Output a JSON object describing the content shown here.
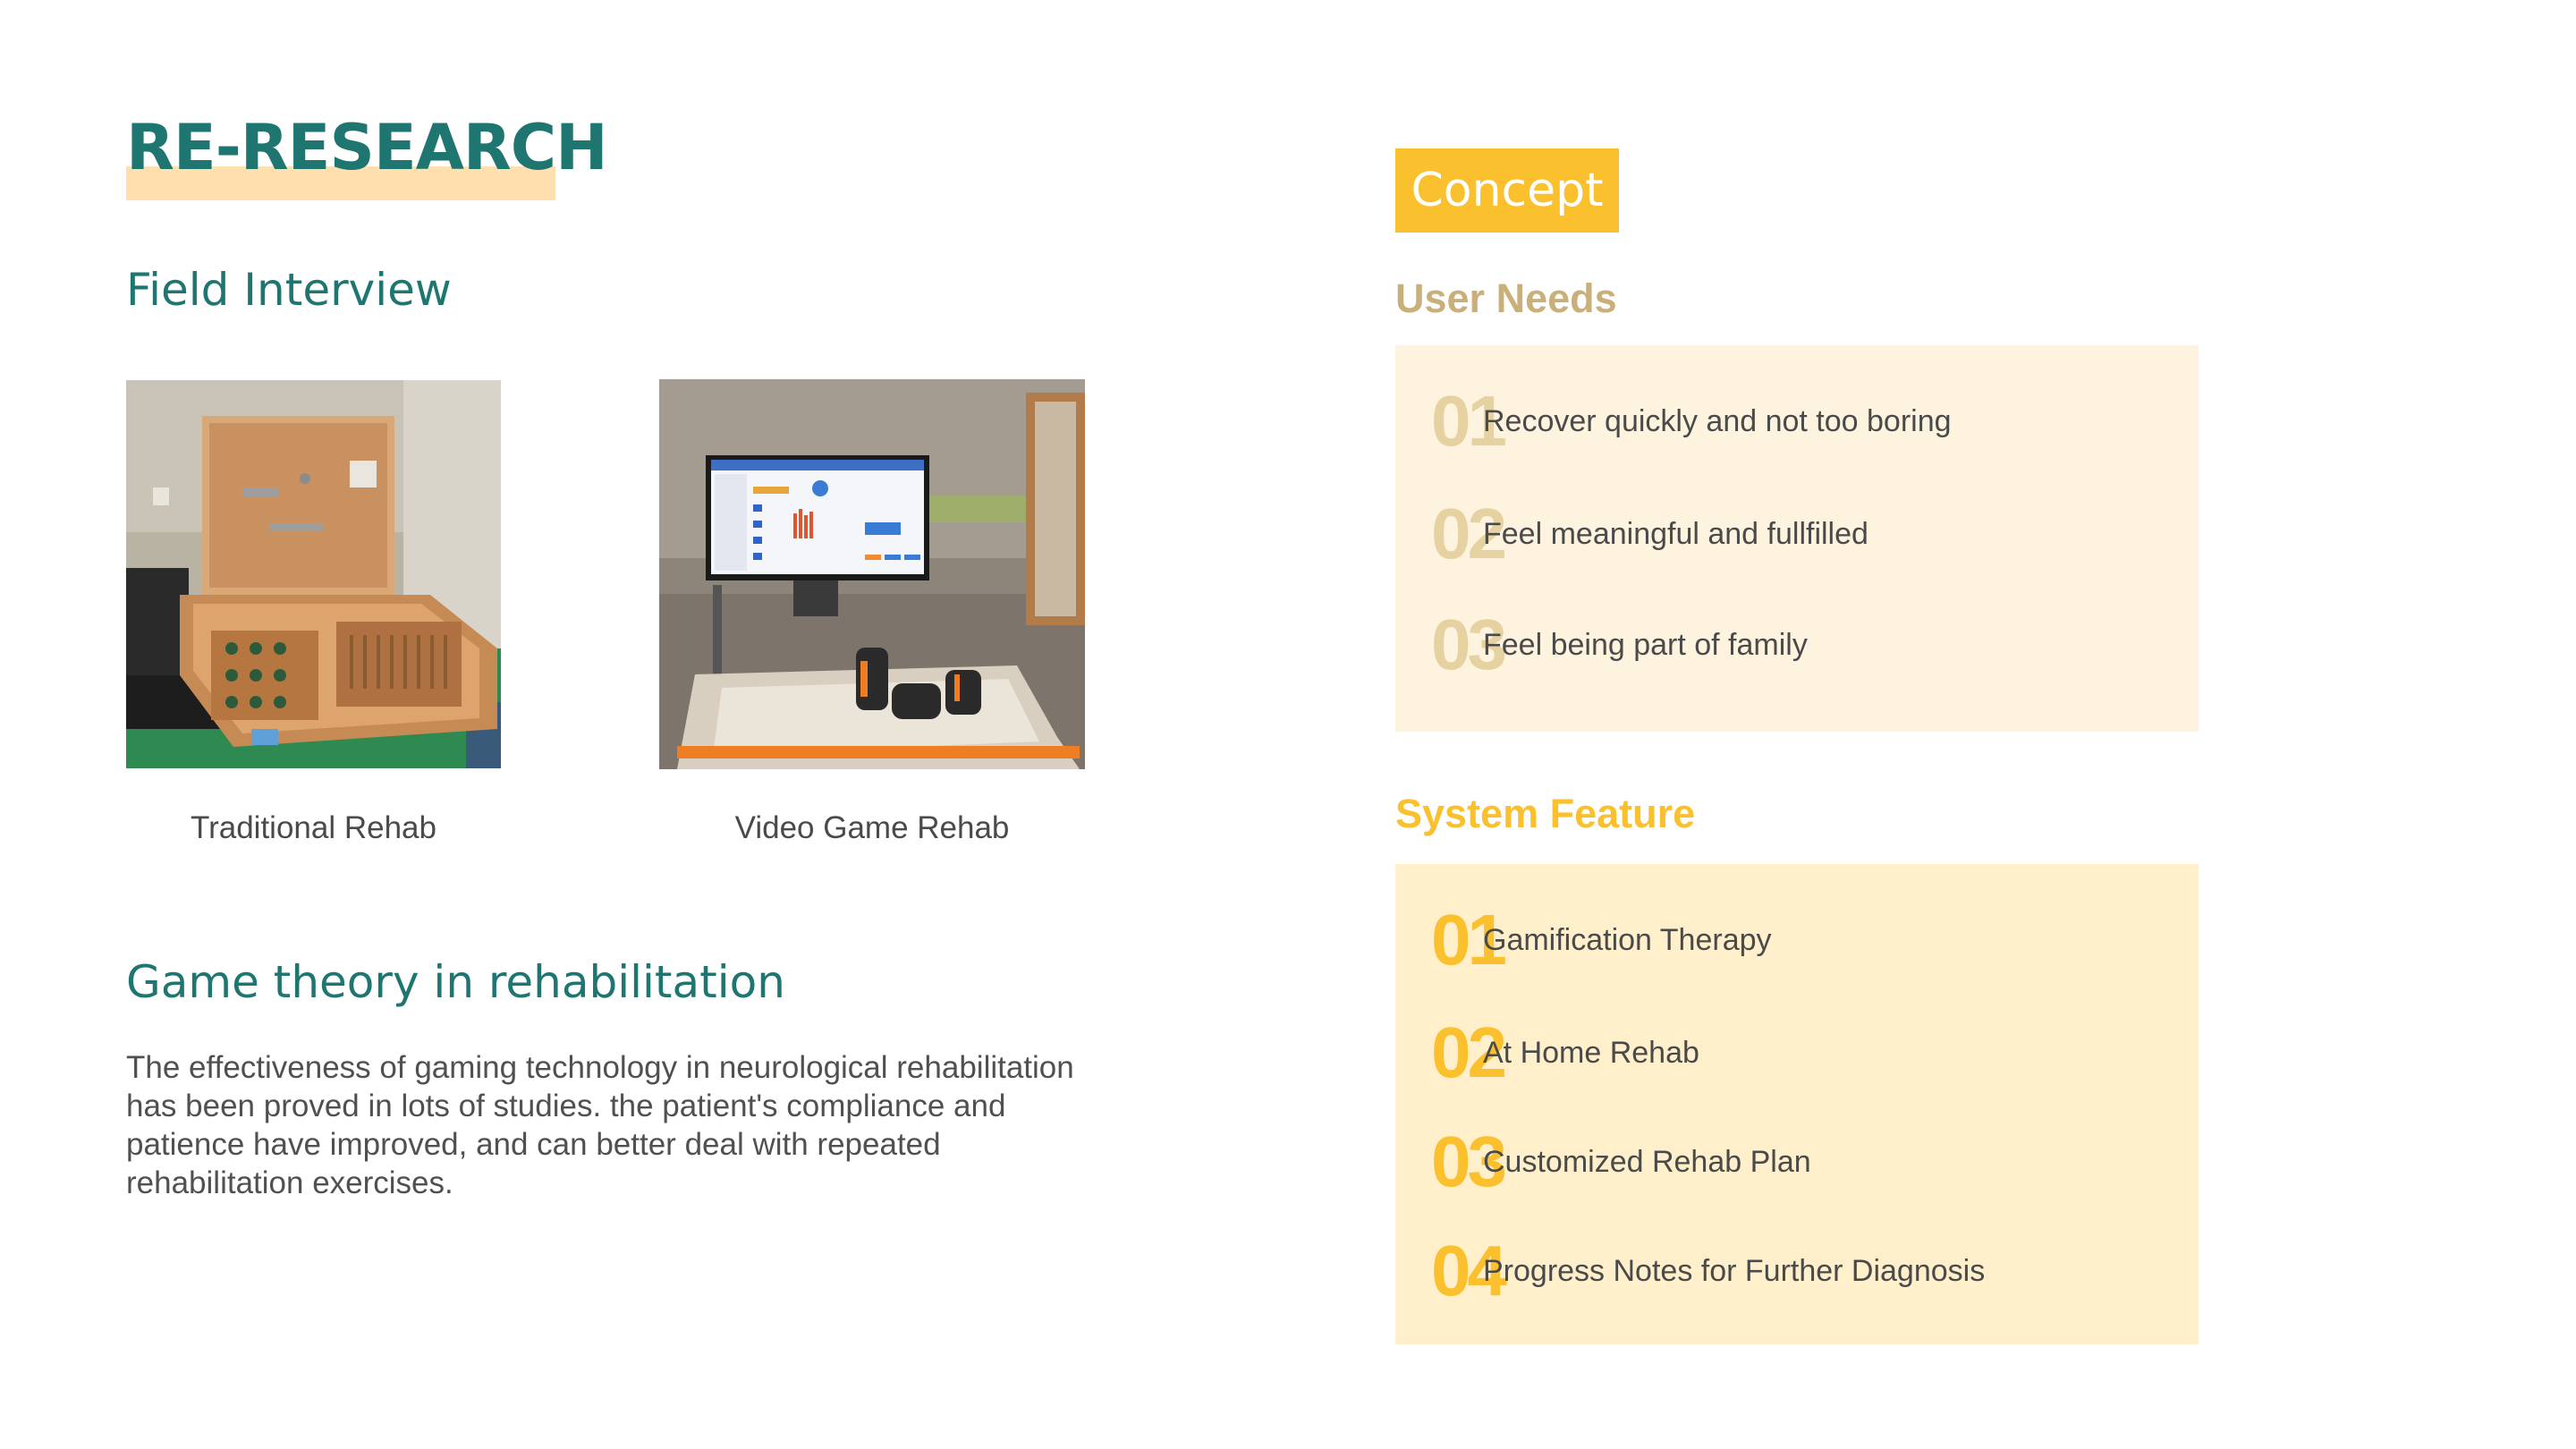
{
  "title": "RE-RESEARCH",
  "field_interview": {
    "heading": "Field Interview",
    "photos": [
      {
        "caption": "Traditional Rehab"
      },
      {
        "caption": "Video Game Rehab"
      }
    ]
  },
  "game_theory": {
    "heading": "Game theory in rehabilitation",
    "body": "The effectiveness of gaming technology in neurological rehabilitation has been proved in lots of studies. the patient's compliance and patience have improved, and can better deal with repeated rehabilitation exercises."
  },
  "concept": {
    "badge": "Concept",
    "user_needs": {
      "label": "User Needs",
      "items": [
        {
          "num": "01",
          "text": "Recover quickly and not too boring"
        },
        {
          "num": "02",
          "text": "Feel meaningful and fullfilled"
        },
        {
          "num": "03",
          "text": "Feel being part of family"
        }
      ]
    },
    "system_feature": {
      "label": "System Feature",
      "items": [
        {
          "num": "01",
          "text": "Gamification Therapy"
        },
        {
          "num": "02",
          "text": "At Home Rehab"
        },
        {
          "num": "03",
          "text": "Customized Rehab Plan"
        },
        {
          "num": "04",
          "text": "Progress Notes for Further Diagnosis"
        }
      ]
    }
  },
  "colors": {
    "teal": "#1f7670",
    "title_highlight": "#ffdfae",
    "gold": "#fbc02d",
    "needs_label": "#c9b07a",
    "needs_panel": "#fdf3df",
    "feature_panel": "#fff0cb"
  }
}
